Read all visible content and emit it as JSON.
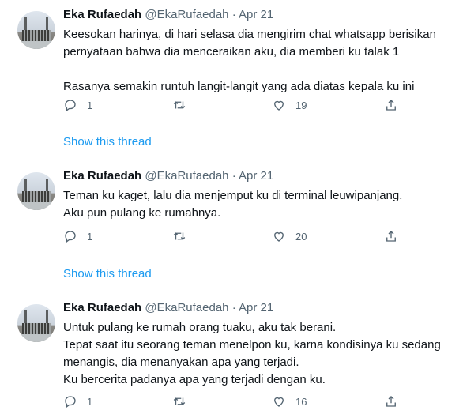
{
  "tweets": [
    {
      "name": "Eka Rufaedah",
      "handle": "@EkaRufaedah",
      "sep": "·",
      "date": "Apr 21",
      "lines": [
        "Keesokan harinya, di hari selasa dia mengirim chat whatsapp berisikan",
        "pernyataan bahwa dia menceraikan aku, dia memberi ku talak 1",
        "",
        "Rasanya semakin runtuh langit-langit yang ada diatas kepala ku ini"
      ],
      "replies": "1",
      "retweets": "",
      "likes": "19",
      "show_thread": "Show this thread"
    },
    {
      "name": "Eka Rufaedah",
      "handle": "@EkaRufaedah",
      "sep": "·",
      "date": "Apr 21",
      "lines": [
        "Teman ku kaget, lalu dia menjemput ku di terminal leuwipanjang.",
        "Aku pun pulang ke rumahnya."
      ],
      "replies": "1",
      "retweets": "",
      "likes": "20",
      "show_thread": "Show this thread"
    },
    {
      "name": "Eka Rufaedah",
      "handle": "@EkaRufaedah",
      "sep": "·",
      "date": "Apr 21",
      "lines": [
        "Untuk pulang ke rumah orang tuaku, aku tak berani.",
        "Tepat saat itu seorang teman menelpon ku, karna kondisinya ku sedang",
        "menangis, dia menanyakan apa yang terjadi.",
        "Ku bercerita padanya apa yang terjadi dengan ku."
      ],
      "replies": "1",
      "retweets": "",
      "likes": "16",
      "show_thread": ""
    }
  ],
  "icons": {
    "reply": "reply-icon",
    "retweet": "retweet-icon",
    "like": "heart-icon",
    "share": "share-icon"
  },
  "colors": {
    "link": "#1d9bf0",
    "muted": "#536471",
    "text": "#0f1419",
    "divider": "#eff3f4"
  }
}
